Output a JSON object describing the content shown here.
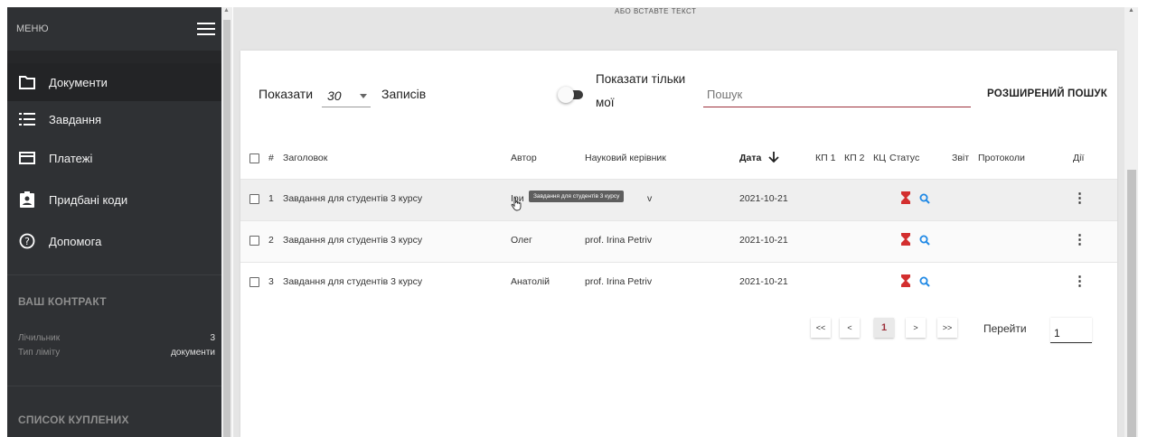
{
  "sidebar": {
    "menu_label": "МЕНЮ",
    "items": [
      {
        "label": "Документи",
        "icon": "folder-icon",
        "active": true
      },
      {
        "label": "Завдання",
        "icon": "list-icon"
      },
      {
        "label": "Платежі",
        "icon": "card-icon"
      },
      {
        "label": "Придбані коди",
        "icon": "badge-icon"
      },
      {
        "label": "Допомога",
        "icon": "help-icon"
      }
    ],
    "contract": {
      "title": "ВАШ КОНТРАКТ",
      "counter_label": "Лічильник",
      "counter_value": "3",
      "limit_label": "Тип ліміту",
      "limit_value": "документи"
    },
    "purchased_title": "СПИСОК КУПЛЕНИХ"
  },
  "top": {
    "paste_text": "АБО ВСТАВТЕ ТЕКСТ"
  },
  "toolbar": {
    "show_label": "Показати",
    "page_size": "30",
    "records_label": "Записів",
    "only_mine_line1": "Показати тільки",
    "only_mine_line2": "мої",
    "search_placeholder": "Пошук",
    "advanced_search": "РОЗШИРЕНИЙ ПОШУК"
  },
  "table": {
    "columns": {
      "num": "#",
      "title": "Заголовок",
      "author": "Автор",
      "supervisor": "Науковий керівник",
      "date": "Дата",
      "kp1": "КП 1",
      "kp2": "КП 2",
      "kc": "КЦ",
      "status": "Статус",
      "report": "Звіт",
      "protocols": "Протоколи",
      "actions": "Дії"
    },
    "rows": [
      {
        "num": "1",
        "title": "Завдання для студентів 3 курсу",
        "author": "Ірина",
        "supervisor": "prof. Irina Petriv",
        "date": "2021-10-21"
      },
      {
        "num": "2",
        "title": "Завдання для студентів 3 курсу",
        "author": "Олег",
        "supervisor": "prof. Irina Petriv",
        "date": "2021-10-21"
      },
      {
        "num": "3",
        "title": "Завдання для студентів 3 курсу",
        "author": "Анатолій",
        "supervisor": "prof. Irina Petriv",
        "date": "2021-10-21"
      }
    ],
    "row1_author_visible": "Іри",
    "row1_supervisor_visible": "v",
    "tooltip": "Завдання для студентів 3 курсу"
  },
  "pagination": {
    "first": "<<",
    "prev": "<",
    "current": "1",
    "next": ">",
    "last": ">>",
    "goto_label": "Перейти",
    "goto_value": "1"
  },
  "colors": {
    "accent": "#9c2f3a",
    "sidebar_bg": "#2f3134",
    "status_hourglass": "#d32f2f",
    "status_search": "#1e88e5"
  }
}
